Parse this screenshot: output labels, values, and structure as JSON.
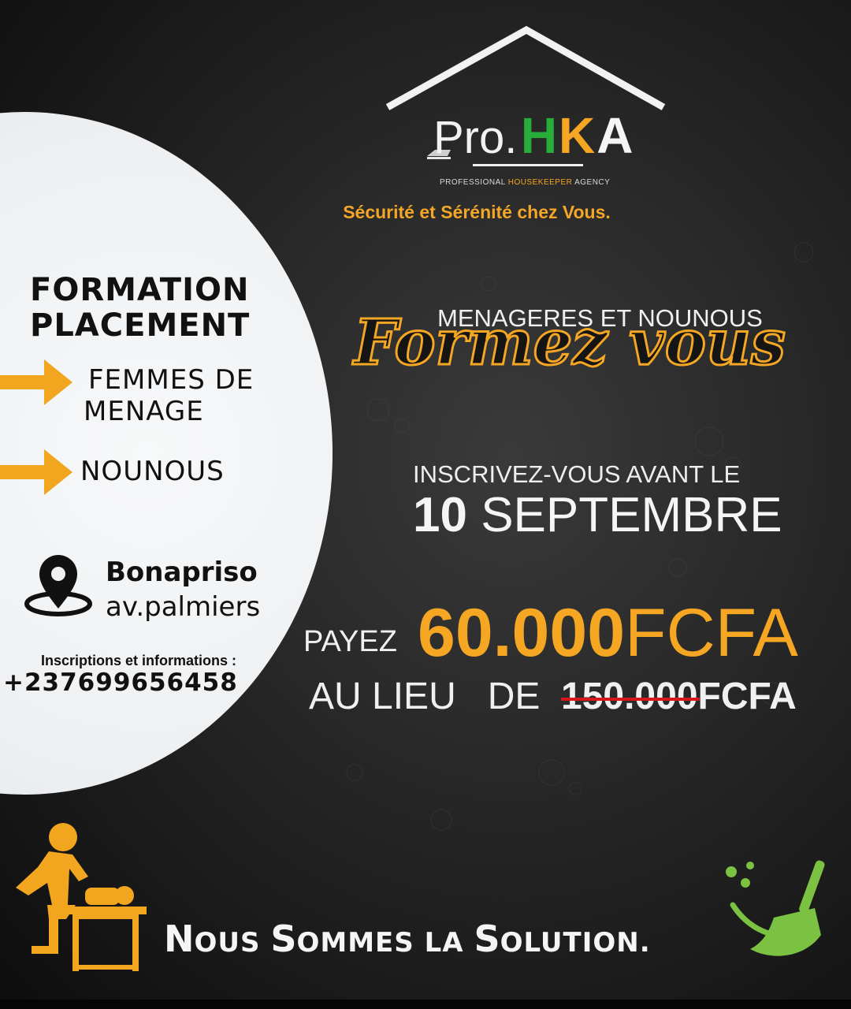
{
  "logo": {
    "pro": "Pro.",
    "hka_h": "H",
    "hka_k": "K",
    "hka_a": "A",
    "subtitle_professional": "PROFESSIONAL ",
    "subtitle_housekeeper": "HOUSEKEEPER",
    "subtitle_agency": " AGENCY"
  },
  "tagline": "Sécurité et Sérénité chez Vous.",
  "formation": {
    "title_line1": "FORMATION",
    "title_line2": "PLACEMENT",
    "item1_line1": "FEMMES DE",
    "item1_line2": "MENAGE",
    "item2": "NOUNOUS"
  },
  "location": {
    "line1": "Bonapriso",
    "line2": "av.palmiers"
  },
  "contact": {
    "label": "Inscriptions et informations :",
    "phone": "+237699656458"
  },
  "headline": {
    "small": "MENAGERES ET NOUNOUS",
    "big": "Formez vous"
  },
  "deadline": {
    "line1": "INSCRIVEZ-VOUS AVANT LE",
    "day": "10",
    "month": "SEPTEMBRE"
  },
  "pricing": {
    "payez": "PAYEZ",
    "price_number": "60.000",
    "price_currency": "FCFA",
    "au_lieu": "AU LIEU   DE ",
    "old_number": "150.000",
    "old_currency": "FCFA"
  },
  "slogan": {
    "n": "N",
    "ous": "OUS ",
    "s": "S",
    "ommes": "OMMES ",
    "la": "LA ",
    "s2": "S",
    "olution": "OLUTION."
  },
  "colors": {
    "accent_orange": "#f5a623",
    "green": "#7bc142",
    "strike_red": "#d8161b",
    "background": "#1c1c1c"
  },
  "icons": [
    "house-roof-icon",
    "arrow-right-icon",
    "location-pin-icon",
    "nanny-diaper-icon",
    "broom-icon"
  ]
}
